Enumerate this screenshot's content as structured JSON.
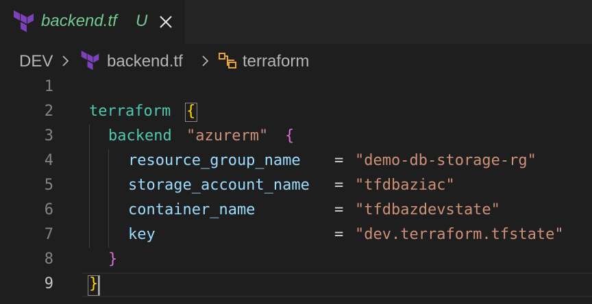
{
  "tab": {
    "title": "backend.tf",
    "status": "U"
  },
  "breadcrumb": {
    "root": "DEV",
    "file": "backend.tf",
    "symbol": "terraform"
  },
  "editor": {
    "line_numbers": [
      "1",
      "2",
      "3",
      "4",
      "5",
      "6",
      "7",
      "8",
      "9"
    ],
    "lines": {
      "l2": {
        "keyword": "terraform",
        "brace": "{"
      },
      "l3": {
        "keyword": "backend",
        "label": "\"azurerm\"",
        "brace": "{"
      },
      "l4": {
        "attr": "resource_group_name  ",
        "op": "= ",
        "value": "\"demo-db-storage-rg\""
      },
      "l5": {
        "attr": "storage_account_name ",
        "op": "= ",
        "value": "\"tfdbaziac\""
      },
      "l6": {
        "attr": "container_name       ",
        "op": "= ",
        "value": "\"tfdbazdevstate\""
      },
      "l7": {
        "attr": "key                  ",
        "op": "= ",
        "value": "\"dev.terraform.tfstate\""
      },
      "l8": {
        "brace": "}"
      },
      "l9": {
        "brace": "}"
      }
    }
  },
  "colors": {
    "background": "#1e1e1e",
    "tab_modified_text": "#73c991",
    "keyword": "#4ec9b0",
    "attribute": "#9cdcfe",
    "string": "#ce9178",
    "brace_level1": "#ffd700",
    "brace_level2": "#da70d6",
    "terraform_purple": "#7b42bc"
  },
  "icons": {
    "tab_icon": "terraform-icon",
    "close": "close-icon",
    "breadcrumb_sep": "chevron-right-icon",
    "symbol": "symbol-structure-icon"
  }
}
